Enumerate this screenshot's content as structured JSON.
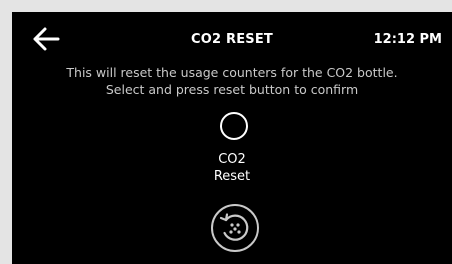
{
  "header": {
    "title": "CO2 RESET",
    "time": "12:12 PM",
    "back_icon": "arrow-left-icon"
  },
  "description": {
    "line1": "This will reset the usage counters for the CO2 bottle.",
    "line2": "Select and press reset button to confirm"
  },
  "option": {
    "label_line1": "CO2",
    "label_line2": "Reset",
    "selected": false
  },
  "reset_button": {
    "icon": "reset-icon"
  },
  "colors": {
    "background": "#000000",
    "text": "#ffffff",
    "muted_text": "#c9c9c9",
    "outer_frame": "#e4e4e4"
  }
}
